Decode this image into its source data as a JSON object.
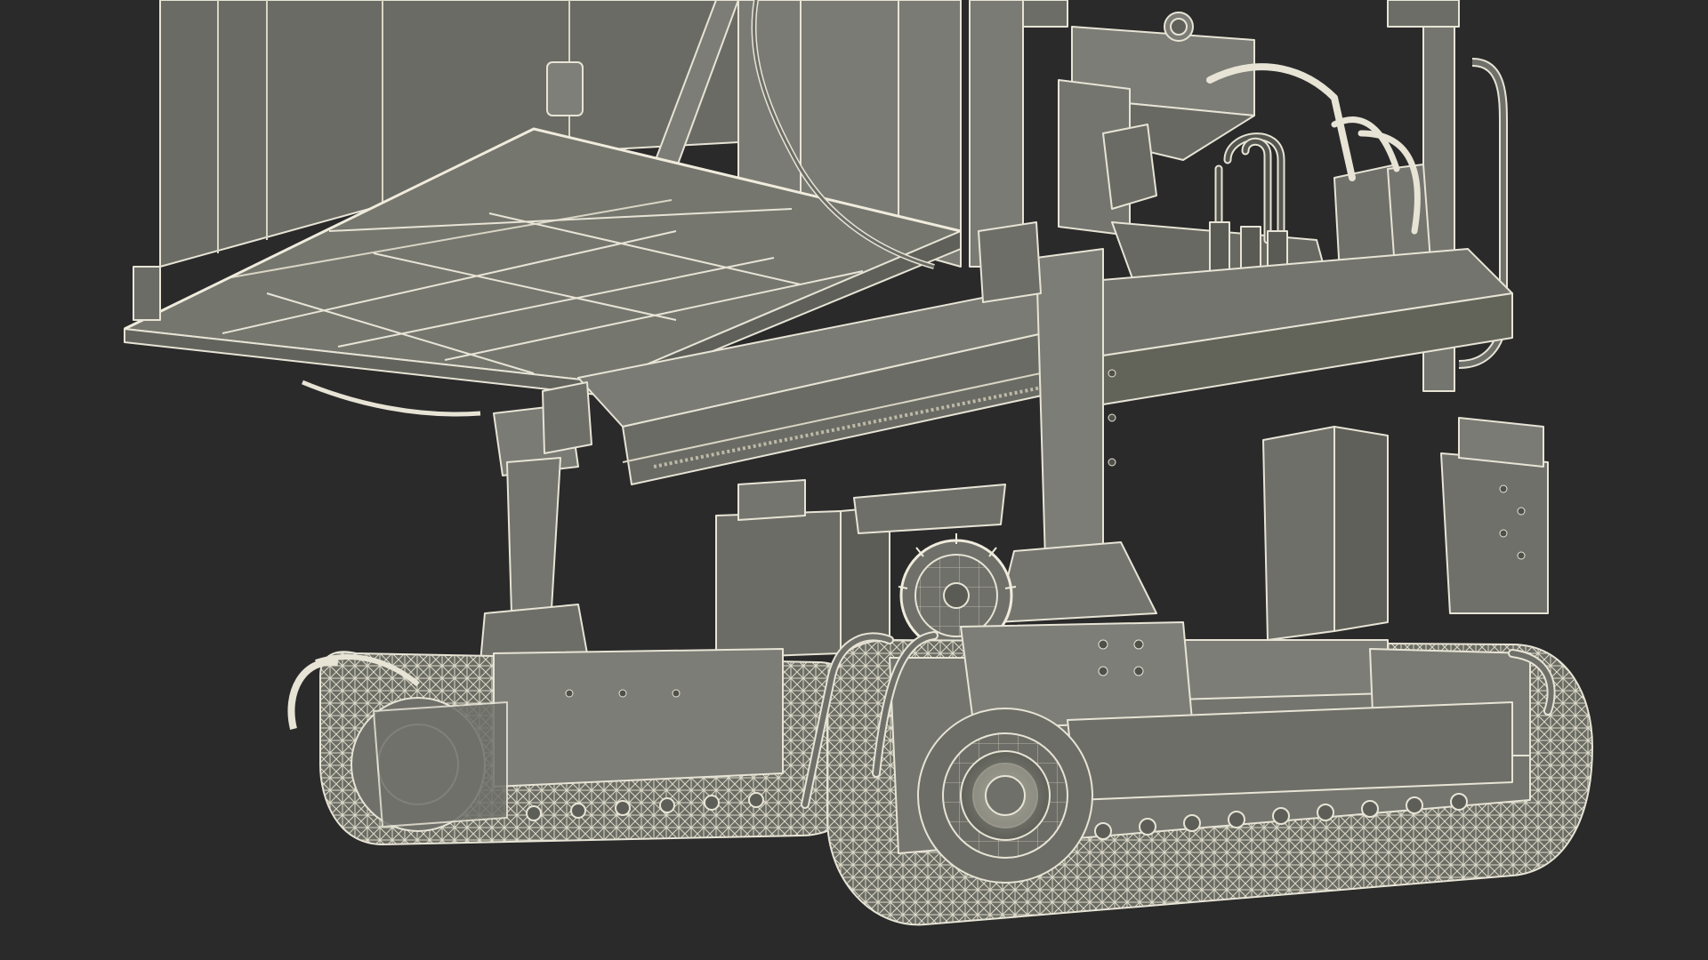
{
  "scene": {
    "subject": "tracked-vehicle-wireframe-render",
    "colors": {
      "background": "#2a2a2a",
      "surface": "#6f706a",
      "surface_light": "#858680",
      "surface_dark": "#57584f",
      "wire": "#e7e4d6",
      "wire_dim": "#bdbaa9"
    }
  }
}
